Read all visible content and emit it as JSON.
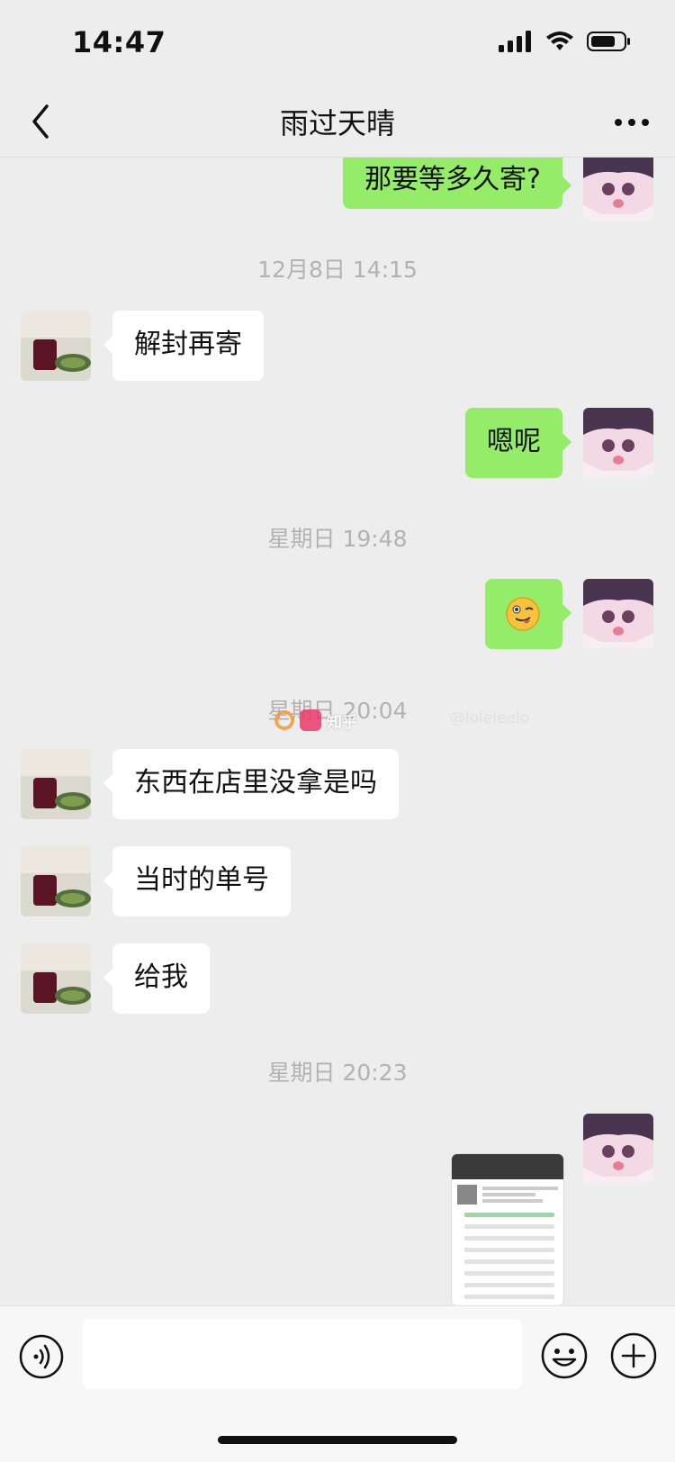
{
  "status": {
    "time": "14:47"
  },
  "nav": {
    "title": "雨过天晴"
  },
  "messages": [
    {
      "side": "right",
      "text": "那要等多久寄?"
    },
    {
      "type": "time",
      "text": "12月8日 14:15"
    },
    {
      "side": "left",
      "text": "解封再寄"
    },
    {
      "side": "right",
      "text": "嗯呢"
    },
    {
      "type": "time",
      "text": "星期日 19:48"
    },
    {
      "side": "right",
      "emoji": "winking-tongue-emoji"
    },
    {
      "type": "time",
      "text": "星期日 20:04"
    },
    {
      "side": "left",
      "text": "东西在店里没拿是吗"
    },
    {
      "side": "left",
      "text": "当时的单号"
    },
    {
      "side": "left",
      "text": "给我"
    },
    {
      "type": "time",
      "text": "星期日 20:23"
    },
    {
      "side": "right",
      "image": "logistics-screenshot"
    }
  ],
  "watermark": {
    "brand": "知乎",
    "handle": "@loleleelo"
  },
  "input": {
    "placeholder": ""
  },
  "colors": {
    "sent_bubble": "#95ec69",
    "received_bubble": "#ffffff",
    "background": "#ededed"
  }
}
